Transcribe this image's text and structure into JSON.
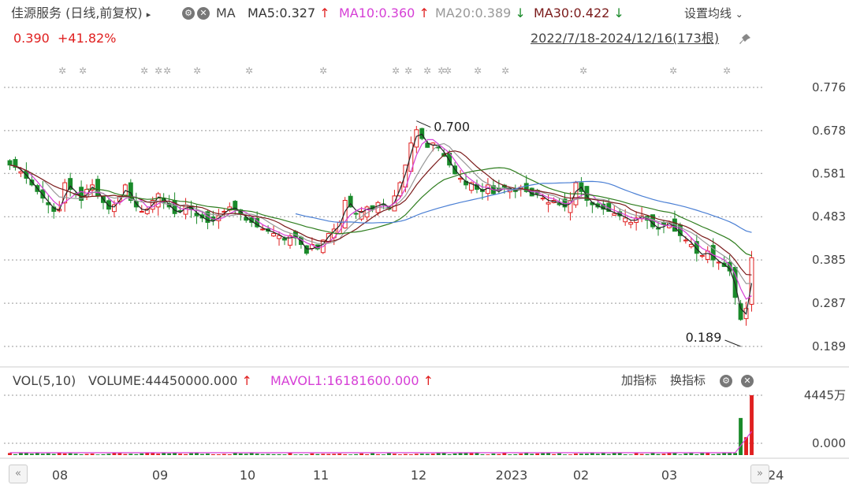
{
  "header": {
    "stock_title": "佳源服务 (日线,前复权)",
    "title_arrow": "▸",
    "ma_label": "MA",
    "ma5": "MA5:0.327",
    "ma5_arrow": "↑",
    "ma10": "MA10:0.360",
    "ma10_arrow": "↑",
    "ma20": "MA20:0.389",
    "ma20_arrow": "↓",
    "ma30": "MA30:0.422",
    "ma30_arrow": "↓",
    "settings": "设置均线",
    "settings_chevron": "⌄",
    "price": "0.390",
    "change": "+41.82%",
    "range": "2022/7/18-2024/12/16(173根)"
  },
  "volume_header": {
    "vol": "VOL(5,10)",
    "volume": "VOLUME:44450000.000",
    "volume_arrow": "↑",
    "mavol": "MAVOL1:16181600.000",
    "mavol_arrow": "↑",
    "add_indicator": "加指标",
    "switch_indicator": "换指标"
  },
  "colors": {
    "up": "#e02020",
    "down": "#1a8a2a",
    "ma5": "#222222",
    "ma10": "#d63fd6",
    "ma20": "#999999",
    "ma30": "#7a1a1a",
    "ma60": "#2e7d1e",
    "ma120": "#4a7fd4",
    "grid": "#999999"
  },
  "icons": {
    "gear": "gear-icon",
    "close": "close-icon",
    "pin": "pin-icon",
    "nav_prev": "chevron-left-icon",
    "nav_next": "chevron-right-icon"
  },
  "chart_data": {
    "type": "candlestick",
    "y_ticks": [
      "0.776",
      "0.678",
      "0.581",
      "0.483",
      "0.385",
      "0.287",
      "0.189"
    ],
    "ylim": [
      0.189,
      0.776
    ],
    "x_ticks": [
      "08",
      "09",
      "10",
      "11",
      "12",
      "2023",
      "02",
      "03",
      "2024"
    ],
    "annotations": [
      {
        "label": "0.700",
        "value": 0.7
      },
      {
        "label": "0.189",
        "value": 0.189
      }
    ],
    "close_path": [
      0.6,
      0.595,
      0.585,
      0.57,
      0.555,
      0.54,
      0.525,
      0.51,
      0.495,
      0.5,
      0.56,
      0.545,
      0.535,
      0.52,
      0.545,
      0.555,
      0.53,
      0.515,
      0.5,
      0.51,
      0.53,
      0.555,
      0.52,
      0.505,
      0.495,
      0.5,
      0.52,
      0.535,
      0.515,
      0.505,
      0.49,
      0.495,
      0.51,
      0.5,
      0.485,
      0.48,
      0.47,
      0.475,
      0.485,
      0.495,
      0.505,
      0.5,
      0.49,
      0.475,
      0.47,
      0.46,
      0.455,
      0.45,
      0.445,
      0.44,
      0.43,
      0.44,
      0.435,
      0.42,
      0.4,
      0.42,
      0.41,
      0.43,
      0.445,
      0.455,
      0.47,
      0.52,
      0.505,
      0.49,
      0.495,
      0.505,
      0.5,
      0.515,
      0.51,
      0.5,
      0.53,
      0.56,
      0.6,
      0.65,
      0.68,
      0.66,
      0.64,
      0.65,
      0.64,
      0.62,
      0.6,
      0.58,
      0.57,
      0.555,
      0.56,
      0.545,
      0.54,
      0.555,
      0.535,
      0.545,
      0.55,
      0.545,
      0.54,
      0.55,
      0.54,
      0.53,
      0.535,
      0.525,
      0.515,
      0.52,
      0.51,
      0.505,
      0.52,
      0.56,
      0.54,
      0.52,
      0.51,
      0.505,
      0.5,
      0.495,
      0.49,
      0.485,
      0.48,
      0.47,
      0.48,
      0.485,
      0.475,
      0.46,
      0.455,
      0.465,
      0.47,
      0.45,
      0.44,
      0.43,
      0.42,
      0.4,
      0.395,
      0.405,
      0.385,
      0.38,
      0.37,
      0.36,
      0.3,
      0.25,
      0.275,
      0.39
    ],
    "series": [
      {
        "name": "MA5",
        "value": 0.327
      },
      {
        "name": "MA10",
        "value": 0.36
      },
      {
        "name": "MA20",
        "value": 0.389
      },
      {
        "name": "MA30",
        "value": 0.422
      }
    ],
    "volume": {
      "y_ticks": [
        "4445万",
        "0.000"
      ],
      "last_volume": 44450000.0,
      "mavol1": 16181600.0
    }
  }
}
